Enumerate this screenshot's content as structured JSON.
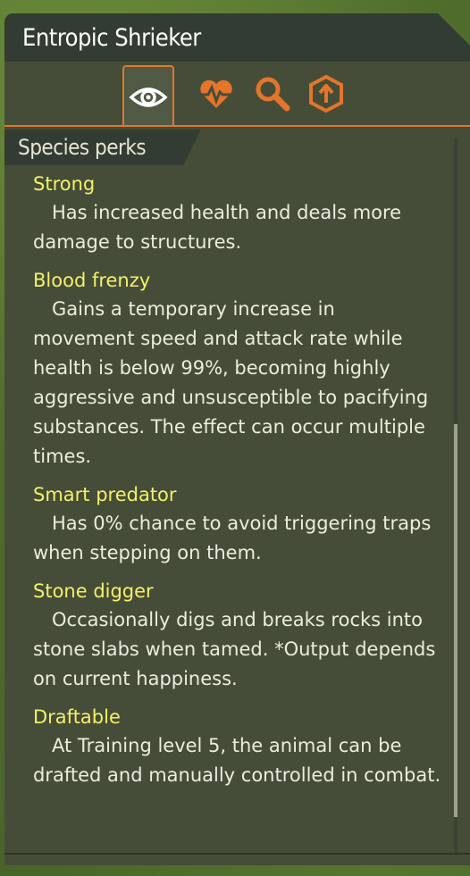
{
  "window": {
    "title": "Entropic Shrieker"
  },
  "tabs": [
    {
      "icon": "eye-icon",
      "active": true
    },
    {
      "icon": "heart-pulse-icon",
      "active": false
    },
    {
      "icon": "magnifier-icon",
      "active": false
    },
    {
      "icon": "upgrade-arrow-icon",
      "active": false
    }
  ],
  "colors": {
    "accent": "#e5752a",
    "perk_name": "#f4f06a",
    "text": "#ecece0"
  },
  "section": {
    "title": "Species perks"
  },
  "perks": [
    {
      "name": "Strong",
      "desc": "Has increased health and deals more damage to structures."
    },
    {
      "name": "Blood frenzy",
      "desc": "Gains a temporary increase in movement speed and attack rate while health is below 99%, becoming highly aggressive and unsusceptible to pacifying substances. The effect can occur multiple times."
    },
    {
      "name": "Smart predator",
      "desc": "Has 0% chance to avoid triggering traps when stepping on them."
    },
    {
      "name": "Stone digger",
      "desc": "Occasionally digs and breaks rocks into stone slabs when tamed. *Output depends on current happiness."
    },
    {
      "name": "Draftable",
      "desc": "At Training level 5, the animal can be drafted and manually controlled in combat."
    }
  ]
}
